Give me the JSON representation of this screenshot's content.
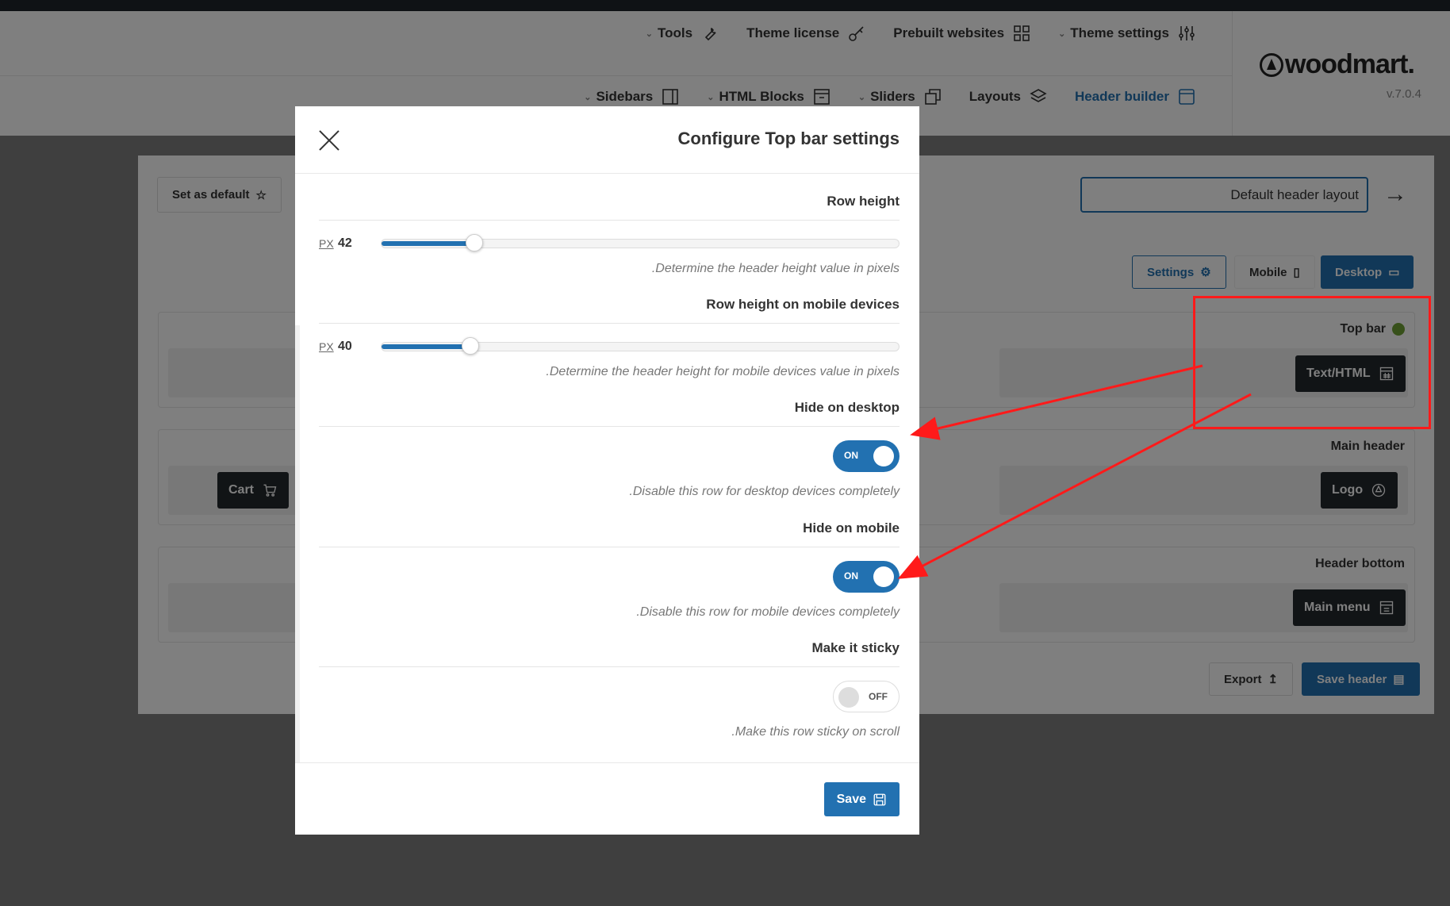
{
  "top_nav": {
    "row1": [
      {
        "label": "Tools",
        "icon": "wrench-icon",
        "chevron": true
      },
      {
        "label": "Theme license",
        "icon": "key-icon",
        "chevron": false
      },
      {
        "label": "Prebuilt websites",
        "icon": "grid-icon",
        "chevron": false
      },
      {
        "label": "Theme settings",
        "icon": "sliders-icon",
        "chevron": true
      }
    ],
    "row2": [
      {
        "label": "Sidebars",
        "icon": "sidebar-icon",
        "chevron": true
      },
      {
        "label": "HTML Blocks",
        "icon": "html-block-icon",
        "chevron": true
      },
      {
        "label": "Sliders",
        "icon": "slides-icon",
        "chevron": true
      },
      {
        "label": "Layouts",
        "icon": "layers-icon",
        "chevron": false
      },
      {
        "label": "Header builder",
        "icon": "window-icon",
        "chevron": false,
        "active": true
      }
    ]
  },
  "brand": {
    "name": "woodmart.",
    "version": "v.7.0.4"
  },
  "builder": {
    "set_default_label": "Set as default",
    "layout_name": "Default header layout",
    "view_buttons": {
      "settings": "Settings",
      "mobile": "Mobile",
      "desktop": "Desktop"
    },
    "rows": [
      {
        "title": "Top bar",
        "status_color": "#6ea035",
        "element": "Text/HTML"
      },
      {
        "title": "Main header",
        "element": "Logo",
        "left_element": "Cart"
      },
      {
        "title": "Header bottom",
        "element": "Main menu"
      }
    ],
    "export_label": "Export",
    "save_header_label": "Save header"
  },
  "modal": {
    "title": "Configure Top bar settings",
    "row_height": {
      "label": "Row height",
      "unit": "PX",
      "value": "42",
      "fraction": 0.18,
      "desc": ".Determine the header height value in pixels"
    },
    "row_height_mobile": {
      "label": "Row height on mobile devices",
      "unit": "PX",
      "value": "40",
      "fraction": 0.172,
      "desc": ".Determine the header height for mobile devices value in pixels"
    },
    "hide_desktop": {
      "label": "Hide on desktop",
      "state": "ON",
      "desc": ".Disable this row for desktop devices completely"
    },
    "hide_mobile": {
      "label": "Hide on mobile",
      "state": "ON",
      "desc": ".Disable this row for mobile devices completely"
    },
    "sticky": {
      "label": "Make it sticky",
      "state": "OFF",
      "desc": ".Make this row sticky on scroll"
    },
    "save_label": "Save"
  },
  "colors": {
    "accent": "#2271b1",
    "annotation": "#ff1a1a",
    "dark_element": "#23282d"
  }
}
